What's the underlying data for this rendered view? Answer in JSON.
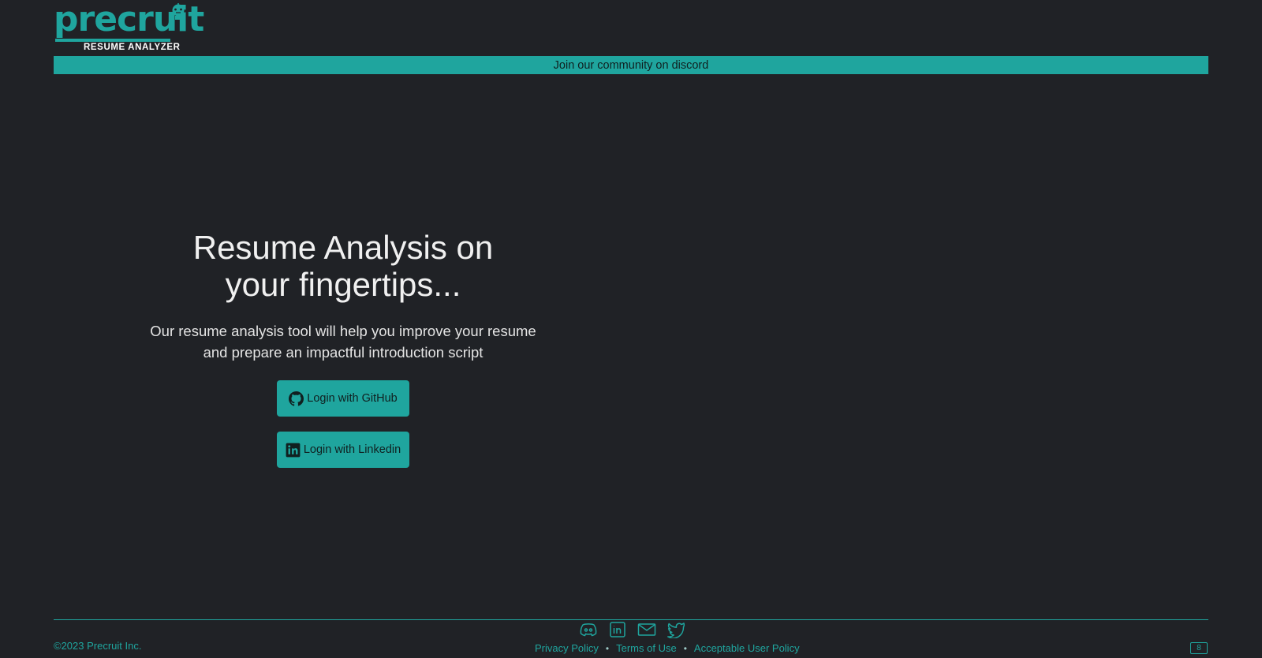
{
  "brand": {
    "name": "precruit",
    "subtitle": "RESUME ANALYZER",
    "accent_color": "#1fa59e",
    "background_color": "#202226"
  },
  "banner": {
    "text": "Join our community on discord"
  },
  "hero": {
    "title_line1": "Resume Analysis on",
    "title_line2": "your fingertips...",
    "subtitle_line1": "Our resume analysis tool will help you improve your resume",
    "subtitle_line2": "and prepare an impactful introduction script"
  },
  "buttons": {
    "github": {
      "label": "Login with GitHub",
      "icon": "github-icon"
    },
    "linkedin": {
      "label": "Login with Linkedin",
      "icon": "linkedin-icon"
    }
  },
  "footer": {
    "copyright": "©2023 Precruit Inc.",
    "social_icons": [
      "discord-icon",
      "linkedin-icon",
      "mail-icon",
      "twitter-icon"
    ],
    "links": [
      "Privacy Policy",
      "Terms of Use",
      "Acceptable User Policy"
    ],
    "separator": "•",
    "badge": "8"
  }
}
